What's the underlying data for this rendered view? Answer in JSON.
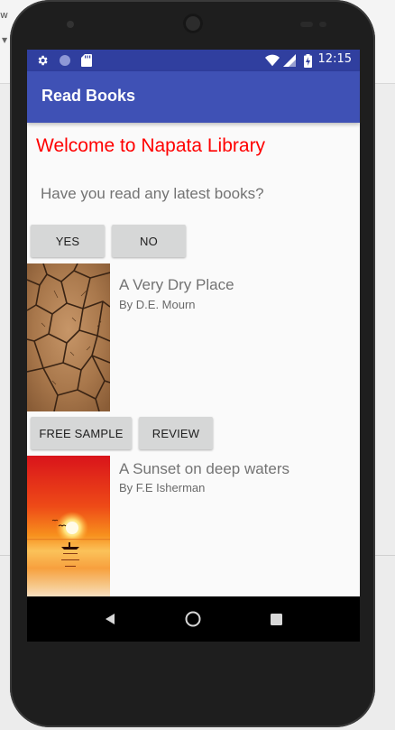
{
  "host": {
    "fragment_text": "w"
  },
  "status_bar": {
    "time": "12:15",
    "icons": [
      "settings-icon",
      "circle-notification-icon",
      "sd-card-icon",
      "wifi-icon",
      "signal-icon",
      "battery-charging-icon"
    ]
  },
  "app_bar": {
    "title": "Read Books"
  },
  "main": {
    "welcome": "Welcome to Napata Library",
    "question": "Have you read any latest books?",
    "yes_label": "YES",
    "no_label": "NO"
  },
  "books": [
    {
      "title": "A Very Dry Place",
      "author": "By D.E. Mourn",
      "image": "cracked-earth-cover"
    },
    {
      "title": "A Sunset on deep waters",
      "author": "By F.E Isherman",
      "image": "sunset-sea-cover"
    }
  ],
  "book_actions": {
    "free_sample_label": "FREE SAMPLE",
    "review_label": "REVIEW"
  },
  "nav_bar": {
    "icons": [
      "back-icon",
      "home-icon",
      "recents-icon"
    ]
  },
  "colors": {
    "status_bar": "#303f9f",
    "app_bar": "#3f51b5",
    "welcome_text": "#ff0000",
    "button_bg": "#d6d7d7"
  }
}
